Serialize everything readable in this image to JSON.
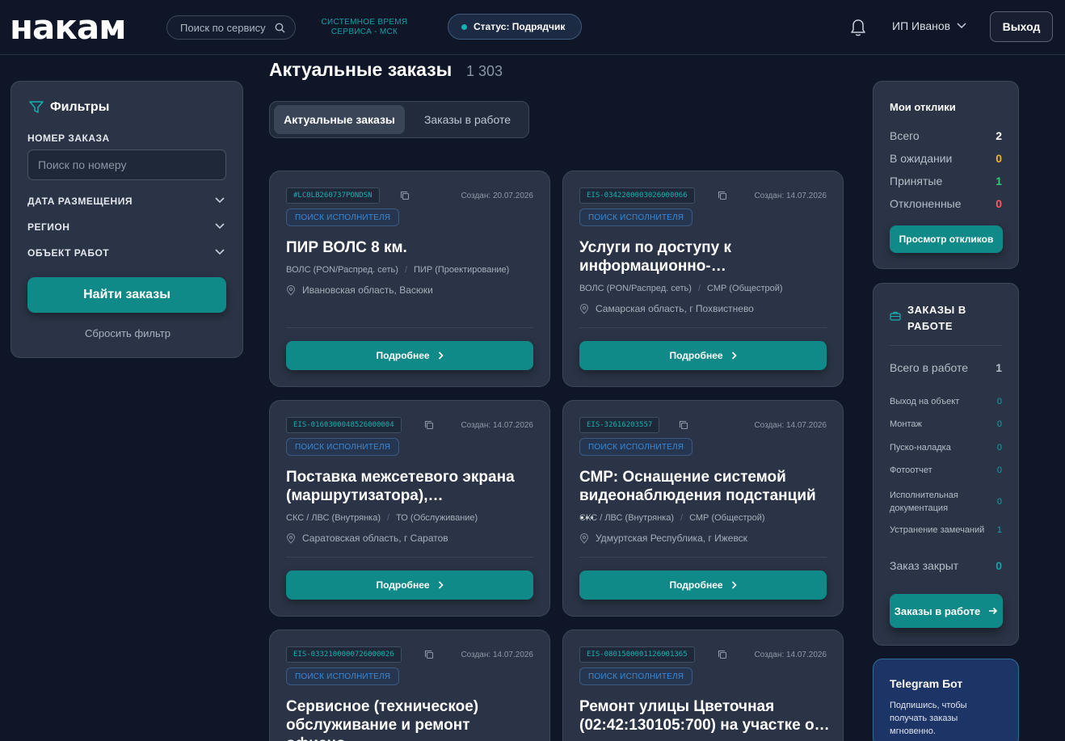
{
  "header": {
    "logo": "накам",
    "search_placeholder": "Поиск по сервису",
    "system_time_line1": "СИСТЕМНОЕ ВРЕМЯ",
    "system_time_line2": "СЕРВИСА - МСК",
    "status": "Статус: Подрядчик",
    "user": "ИП Иванов",
    "logout": "Выход"
  },
  "filters": {
    "title": "Фильтры",
    "order_number_label": "НОМЕР ЗАКАЗА",
    "order_number_placeholder": "Поиск по номеру",
    "date_label": "ДАТА РАЗМЕЩЕНИЯ",
    "region_label": "РЕГИОН",
    "object_label": "ОБЪЕКТ РАБОТ",
    "find_button": "Найти заказы",
    "reset": "Сбросить фильтр"
  },
  "main": {
    "title": "Актуальные заказы",
    "count": "1 303",
    "tabs": [
      {
        "label": "Актуальные заказы",
        "active": true
      },
      {
        "label": "Заказы в работе",
        "active": false
      }
    ],
    "cards": [
      {
        "code": "#LC0LB260737PONDSN",
        "created": "Создан: 20.07.2026",
        "badge": "ПОИСК ИСПОЛНИТЕЛЯ",
        "title": "ПИР ВОЛС 8 км.",
        "tag1": "ВОЛС (PON/Распред. сеть)",
        "tag2": "ПИР (Проектирование)",
        "location": "Ивановская область, Васюки",
        "button": "Подробнее"
      },
      {
        "code": "EIS-0342200003026000066",
        "created": "Создан: 14.07.2026",
        "badge": "ПОИСК ИСПОЛНИТЕЛЯ",
        "title": "Услуги по доступу к информационно-…",
        "tag1": "ВОЛС (PON/Распред. сеть)",
        "tag2": "СМР (Общестрой)",
        "location": "Самарская область, г Похвистнево",
        "button": "Подробнее"
      },
      {
        "code": "EIS-0160300048526000004",
        "created": "Создан: 14.07.2026",
        "badge": "ПОИСК ИСПОЛНИТЕЛЯ",
        "title": "Поставка межсетевого экрана (маршрутизатора),…",
        "tag1": "СКС / ЛВС (Внутрянка)",
        "tag2": "ТО (Обслуживание)",
        "location": "Саратовская область, г Саратов",
        "button": "Подробнее"
      },
      {
        "code": "EIS-32616203557",
        "created": "Создан: 14.07.2026",
        "badge": "ПОИСК ИСПОЛНИТЕЛЯ",
        "title": "СМР: Оснащение системой видеонаблюдения подстанций …",
        "tag1": "СКС / ЛВС (Внутрянка)",
        "tag2": "СМР (Общестрой)",
        "location": "Удмуртская Республика, г Ижевск",
        "button": "Подробнее"
      },
      {
        "code": "EIS-0332100000726000026",
        "created": "Создан: 14.07.2026",
        "badge": "ПОИСК ИСПОЛНИТЕЛЯ",
        "title": "Сервисное (техническое) обслуживание и ремонт офисно…",
        "tag1": "",
        "tag2": "",
        "location": "",
        "button": ""
      },
      {
        "code": "EIS-0801500001126001365",
        "created": "Создан: 14.07.2026",
        "badge": "ПОИСК ИСПОЛНИТЕЛЯ",
        "title": "Ремонт улицы Цветочная (02:42:130105:700) на участке о…",
        "tag1": "",
        "tag2": "",
        "location": "",
        "button": ""
      }
    ]
  },
  "responses": {
    "title": "Мои отклики",
    "rows": [
      {
        "label": "Всего",
        "value": "2",
        "color": "#ffffff"
      },
      {
        "label": "В ожидании",
        "value": "0",
        "color": "#f0b429"
      },
      {
        "label": "Принятые",
        "value": "1",
        "color": "#2ecc71"
      },
      {
        "label": "Отклоненные",
        "value": "0",
        "color": "#ff5a5f"
      }
    ],
    "button": "Просмотр откликов"
  },
  "in_work": {
    "title_line1": "ЗАКАЗЫ В",
    "title_line2": "РАБОТЕ",
    "total_label": "Всего в работе",
    "total_value": "1",
    "rows": [
      {
        "label": "Выход на объект",
        "value": "0"
      },
      {
        "label": "Монтаж",
        "value": "0"
      },
      {
        "label": "Пуско-наладка",
        "value": "0"
      },
      {
        "label": "Фотоотчет",
        "value": "0"
      },
      {
        "label": "Исполнительная документация",
        "value": "0"
      },
      {
        "label": "Устранение замечаний",
        "value": "1"
      }
    ],
    "closed_label": "Заказ закрыт",
    "closed_value": "0",
    "button": "Заказы в работе"
  },
  "telegram": {
    "title": "Telegram Бот",
    "text": "Подпишись, чтобы получать заказы мгновенно."
  },
  "colors": {
    "accent": "#0f8a88",
    "background": "#0f1628",
    "panel": "#2a3446"
  }
}
